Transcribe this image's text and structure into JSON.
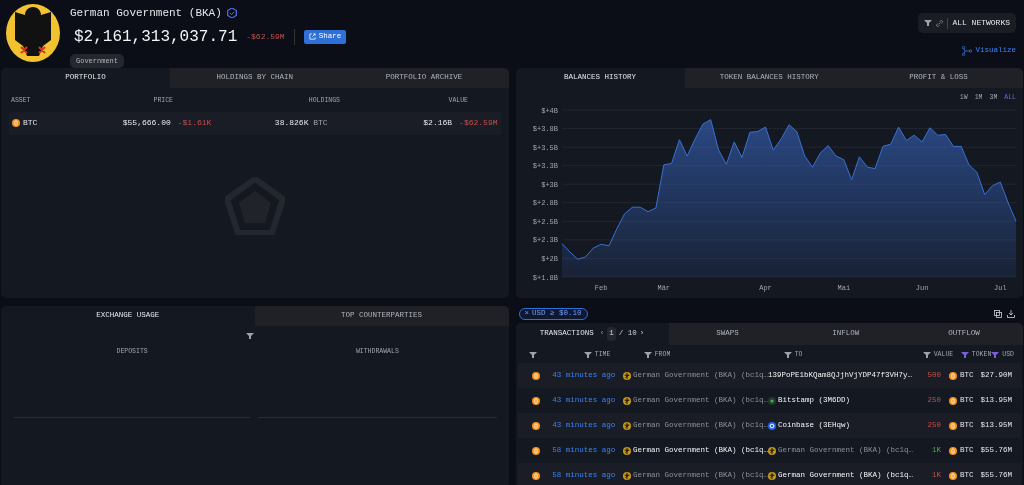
{
  "entity": {
    "name": "German Government (BKA)",
    "verified": true,
    "balance": "$2,161,313,037.71",
    "change": "-$62.59M",
    "share_label": "Share",
    "tag": "Government"
  },
  "network_filter": {
    "label": "ALL NETWORKS"
  },
  "visualize": {
    "label": "Visualize"
  },
  "portfolio": {
    "tabs": [
      {
        "label": "PORTFOLIO",
        "selected": true
      },
      {
        "label": "HOLDINGS BY CHAIN",
        "selected": false
      },
      {
        "label": "PORTFOLIO ARCHIVE",
        "selected": false
      }
    ],
    "columns": [
      "ASSET",
      "PRICE",
      "HOLDINGS",
      "VALUE"
    ],
    "rows": [
      {
        "asset": "BTC",
        "price": "$55,666.00",
        "price_change": "-$1.61K",
        "holdings": "38.826K",
        "holdings_unit": "BTC",
        "value": "$2.16B",
        "value_change": "-$62.59M"
      }
    ]
  },
  "balances": {
    "tabs": [
      {
        "label": "BALANCES HISTORY",
        "selected": true
      },
      {
        "label": "TOKEN BALANCES HISTORY",
        "selected": false
      },
      {
        "label": "PROFIT & LOSS",
        "selected": false
      }
    ],
    "ranges": [
      {
        "label": "1W",
        "selected": false
      },
      {
        "label": "1M",
        "selected": false
      },
      {
        "label": "3M",
        "selected": false
      },
      {
        "label": "ALL",
        "selected": true
      }
    ],
    "chart_data": {
      "type": "area",
      "categories": [
        null,
        null,
        null,
        null,
        null,
        "Feb",
        null,
        null,
        null,
        null,
        null,
        null,
        null,
        "Mär",
        null,
        null,
        null,
        null,
        null,
        null,
        null,
        null,
        null,
        null,
        null,
        null,
        "Apr",
        null,
        null,
        null,
        null,
        null,
        null,
        null,
        null,
        null,
        "Mai",
        null,
        null,
        null,
        null,
        null,
        null,
        null,
        null,
        null,
        "Jun",
        null,
        null,
        null,
        null,
        null,
        null,
        null,
        null,
        null,
        "Jul",
        null,
        null
      ],
      "series": [
        {
          "color": "#3b6fd4",
          "values": [
            2.2,
            2.09,
            1.99,
            2.02,
            2.14,
            2.19,
            2.17,
            2.4,
            2.6,
            2.69,
            2.69,
            2.63,
            2.68,
            3.26,
            3.28,
            3.6,
            3.38,
            3.61,
            3.81,
            3.87,
            3.46,
            3.27,
            3.57,
            3.36,
            3.7,
            3.71,
            3.77,
            3.46,
            3.61,
            3.8,
            3.71,
            3.38,
            3.23,
            3.42,
            3.52,
            3.38,
            3.33,
            3.06,
            3.37,
            3.23,
            3.21,
            3.51,
            3.54,
            3.77,
            3.59,
            3.66,
            3.57,
            3.76,
            3.66,
            3.67,
            3.51,
            3.51,
            3.26,
            3.16,
            2.86,
            2.98,
            3.03,
            2.75,
            2.5
          ]
        }
      ],
      "ylim": [
        1.75,
        4.0
      ],
      "grid": true,
      "yticks": [
        {
          "value": 1.75,
          "label": "$+1.8B"
        },
        {
          "value": 2.0,
          "label": "$+2B"
        },
        {
          "value": 2.25,
          "label": "$+2.3B"
        },
        {
          "value": 2.5,
          "label": "$+2.5B"
        },
        {
          "value": 2.75,
          "label": "$+2.8B"
        },
        {
          "value": 3.0,
          "label": "$+3B"
        },
        {
          "value": 3.25,
          "label": "$+3.3B"
        },
        {
          "value": 3.5,
          "label": "$+3.5B"
        },
        {
          "value": 3.75,
          "label": "$+3.8B"
        },
        {
          "value": 4.0,
          "label": "$+4B"
        }
      ]
    }
  },
  "exchange": {
    "tabs": [
      {
        "label": "EXCHANGE USAGE",
        "selected": true
      },
      {
        "label": "TOP COUNTERPARTIES",
        "selected": false
      }
    ],
    "columns": [
      "DEPOSITS",
      "WITHDRAWALS"
    ]
  },
  "filter_chip": {
    "remove_icon": "×",
    "label": "USD ≥ $0.10"
  },
  "transactions": {
    "tabs": [
      {
        "label": "TRANSACTIONS",
        "selected": true
      },
      {
        "label": "SWAPS",
        "selected": false
      },
      {
        "label": "INFLOW",
        "selected": false
      },
      {
        "label": "OUTFLOW",
        "selected": false
      }
    ],
    "page": {
      "previous": "‹",
      "current": "1",
      "total": "/ 10",
      "next": "›"
    },
    "columns": [
      {
        "label": "TIME",
        "filtered": false
      },
      {
        "label": "FROM",
        "filtered": false
      },
      {
        "label": "TO",
        "filtered": false
      },
      {
        "label": "VALUE",
        "filtered": false
      },
      {
        "label": "TOKEN",
        "filtered": true
      },
      {
        "label": "USD",
        "filtered": true
      }
    ],
    "rows": [
      {
        "time": "43 minutes ago",
        "from": "German Government (BKA) (bc1q…",
        "from_highlighted": false,
        "to": {
          "kind": "address",
          "label": "139PoPE1bKQam8QJjhVjYDP47f3VH7y…",
          "highlighted": true
        },
        "value": "500",
        "incoming": false,
        "token": "BTC",
        "usd": "$27.90M"
      },
      {
        "time": "43 minutes ago",
        "from": "German Government (BKA) (bc1q…",
        "from_highlighted": false,
        "to": {
          "kind": "bitstamp",
          "label": "Bitstamp (3M6DD)",
          "highlighted": true
        },
        "value": "250",
        "incoming": false,
        "token": "BTC",
        "usd": "$13.95M"
      },
      {
        "time": "43 minutes ago",
        "from": "German Government (BKA) (bc1q…",
        "from_highlighted": false,
        "to": {
          "kind": "coinbase",
          "label": "Coinbase (3EHqw)",
          "highlighted": true
        },
        "value": "250",
        "incoming": false,
        "token": "BTC",
        "usd": "$13.95M"
      },
      {
        "time": "58 minutes ago",
        "from": "German Government (BKA) (bc1q…",
        "from_highlighted": true,
        "to": {
          "kind": "government",
          "label": "German Government (BKA) (bc1q…",
          "highlighted": false
        },
        "value": "1K",
        "incoming": true,
        "token": "BTC",
        "usd": "$55.76M"
      },
      {
        "time": "58 minutes ago",
        "from": "German Government (BKA) (bc1q…",
        "from_highlighted": false,
        "to": {
          "kind": "government",
          "label": "German Government (BKA) (bc1q…",
          "highlighted": true
        },
        "value": "1K",
        "incoming": false,
        "token": "BTC",
        "usd": "$55.76M"
      }
    ]
  }
}
